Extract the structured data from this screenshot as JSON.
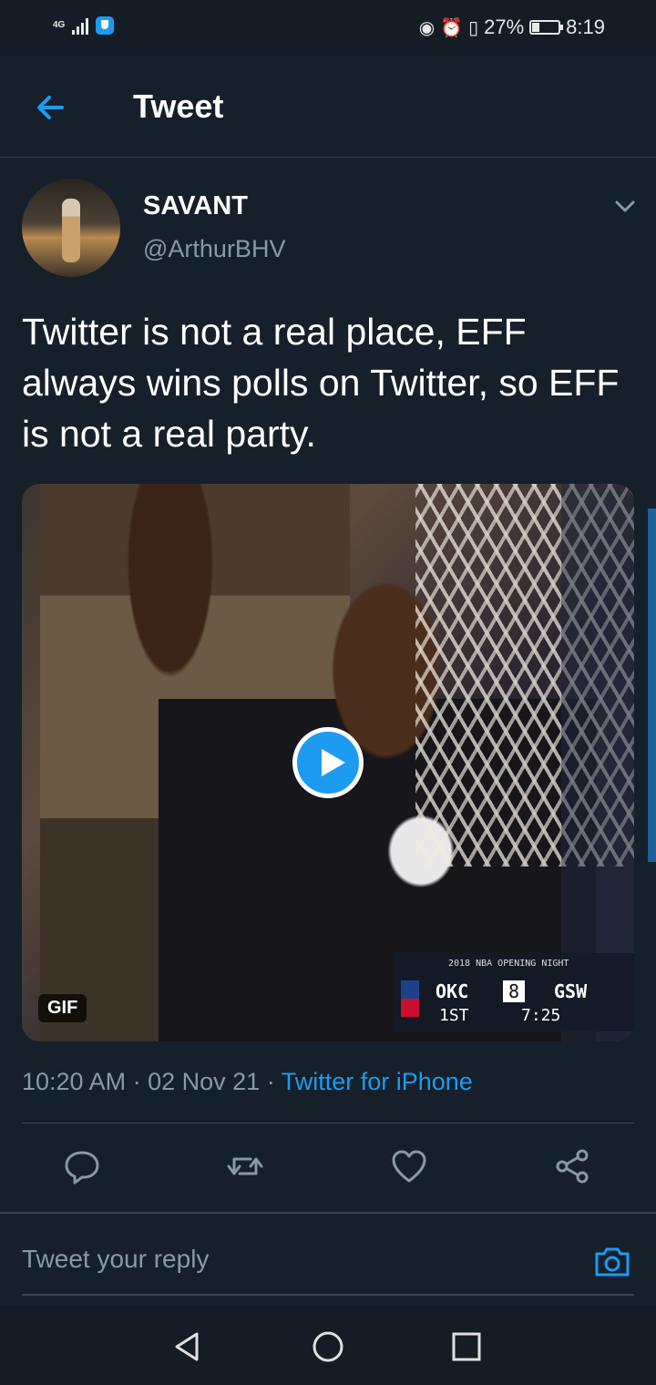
{
  "status_bar": {
    "network": "4G",
    "battery_percent": "27%",
    "battery_level": 0.27,
    "time": "8:19",
    "icons": [
      "signal-icon",
      "vpn-shield-icon",
      "eye-icon",
      "alarm-icon",
      "vibrate-icon",
      "battery-icon"
    ]
  },
  "header": {
    "title": "Tweet",
    "back_icon": "arrow-left-icon"
  },
  "tweet": {
    "author_name": "SAVANT",
    "author_handle": "@ArthurBHV",
    "text": "Twitter is not a real place, EFF always wins polls on Twitter, so EFF is not a real party.",
    "media": {
      "badge": "GIF",
      "scoreboard": {
        "title": "2018 NBA OPENING NIGHT",
        "team1": "OKC",
        "score1": "8",
        "team2": "GSW",
        "period": "1ST",
        "clock": "7:25"
      }
    },
    "time": "10:20 AM",
    "date": "02 Nov 21",
    "separator": "·",
    "source": "Twitter for iPhone"
  },
  "actions": [
    "reply-icon",
    "retweet-icon",
    "like-icon",
    "share-icon"
  ],
  "reply_bar": {
    "placeholder": "Tweet your reply",
    "camera_icon": "camera-icon"
  },
  "nav": [
    "back-triangle-icon",
    "home-circle-icon",
    "recents-square-icon"
  ],
  "colors": {
    "background": "#15202b",
    "accent": "#1d9bf0",
    "muted": "#8899a6",
    "divider": "#38444d"
  }
}
